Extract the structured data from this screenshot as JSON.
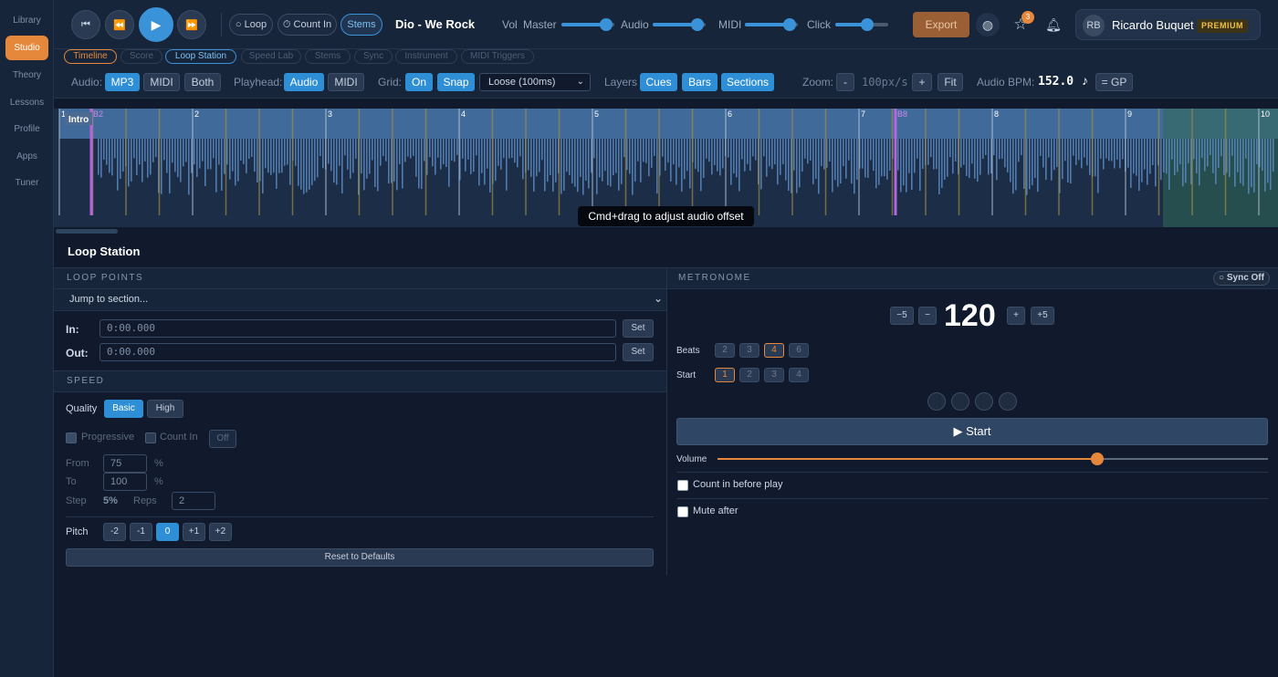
{
  "sidebar": {
    "items": [
      {
        "label": "Library"
      },
      {
        "label": "Studio"
      },
      {
        "label": "Theory"
      },
      {
        "label": "Lessons"
      },
      {
        "label": "Profile"
      },
      {
        "label": "Apps"
      },
      {
        "label": "Tuner"
      }
    ],
    "active": "Studio"
  },
  "topbar": {
    "loop_label": "Loop",
    "countin_label": "Count In",
    "stems_label": "Stems",
    "song_title": "Dio - We Rock",
    "vol_label": "Vol",
    "master_label": "Master",
    "master_level": 0.85,
    "audio_label": "Audio",
    "audio_level": 0.85,
    "midi_label": "MIDI",
    "midi_level": 0.85,
    "click_label": "Click",
    "click_level": 0.6,
    "export_label": "Export",
    "notif_count": "3",
    "user_initials": "RB",
    "user_name": "Ricardo Buquet",
    "user_tier": "PREMIUM"
  },
  "tabs": [
    "Timeline",
    "Score",
    "Loop Station",
    "Speed Lab",
    "Stems",
    "Sync",
    "Instrument",
    "MIDI Triggers"
  ],
  "toolbar": {
    "audio_label": "Audio:",
    "audio_opts": [
      "MP3",
      "MIDI",
      "Both"
    ],
    "playhead_label": "Playhead:",
    "playhead_opts": [
      "Audio",
      "MIDI"
    ],
    "grid_label": "Grid:",
    "grid_on": "On",
    "snap": "Snap",
    "grid_select": "Loose (100ms)",
    "layers_label": "Layers",
    "layers": [
      "Cues",
      "Bars",
      "Sections"
    ],
    "zoom_label": "Zoom:",
    "zoom_minus": "-",
    "zoom_value": "100px/s",
    "zoom_plus": "+",
    "fit": "Fit",
    "bpm_label": "Audio BPM:",
    "bpm_value": "152.0",
    "note_glyph": "♪",
    "gp": "= GP"
  },
  "timeline": {
    "bar_numbers": [
      "1",
      "2",
      "3",
      "4",
      "5",
      "6",
      "7",
      "8",
      "9",
      "10"
    ],
    "section_label": "Intro",
    "marker_b2": "B2",
    "marker_b8": "B8",
    "tooltip": "Cmd+drag to adjust audio offset"
  },
  "loop_station": {
    "title": "Loop Station",
    "loop_points_head": "LOOP POINTS",
    "jump_placeholder": "Jump to section...",
    "in_label": "In:",
    "in_value": "0:00.000",
    "out_label": "Out:",
    "out_value": "0:00.000",
    "set_label": "Set",
    "speed_head": "SPEED",
    "quality_label": "Quality",
    "quality_opts": [
      "Basic",
      "High"
    ],
    "progressive_label": "Progressive",
    "countin_label": "Count In",
    "off_label": "Off",
    "from_label": "From",
    "from_value": "75",
    "pct": "%",
    "to_label": "To",
    "to_value": "100",
    "step_label": "Step",
    "step_value": "5%",
    "reps_label": "Reps",
    "reps_value": "2",
    "pitch_label": "Pitch",
    "pitch_opts": [
      "-2",
      "-1",
      "0",
      "+1",
      "+2"
    ],
    "reset_label": "Reset to Defaults"
  },
  "metronome": {
    "head": "METRONOME",
    "sync_label": "○ Sync Off",
    "minus5": "−5",
    "minus1": "−",
    "tempo": "120",
    "plus1": "+",
    "plus5": "+5",
    "beats_label": "Beats",
    "beats_opts": [
      "2",
      "3",
      "4",
      "6"
    ],
    "start_label": "Start",
    "start_opts": [
      "1",
      "2",
      "3",
      "4"
    ],
    "start_button": "▶ Start",
    "volume_label": "Volume",
    "volume_level": 0.69,
    "countin_label": "Count in before play",
    "mute_label": "Mute after"
  },
  "colors": {
    "accent_blue": "#2f8fd6",
    "accent_orange": "#e6883b",
    "purple_marker": "#b565e0"
  }
}
